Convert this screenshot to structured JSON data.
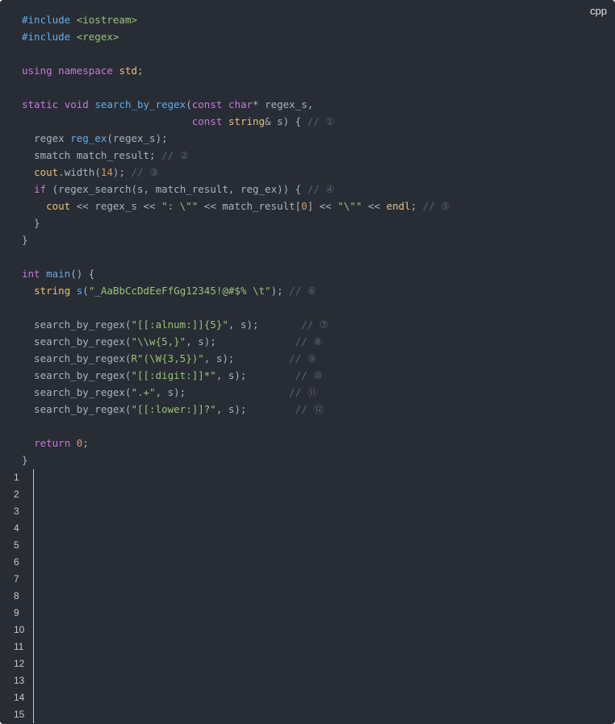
{
  "code_block": {
    "language_label": "cpp",
    "lines": [
      [
        [
          "meta",
          "#include "
        ],
        [
          "str",
          "<iostream>"
        ]
      ],
      [
        [
          "meta",
          "#include "
        ],
        [
          "str",
          "<regex>"
        ]
      ],
      [],
      [
        [
          "kw",
          "using"
        ],
        [
          "plain",
          " "
        ],
        [
          "kw",
          "namespace"
        ],
        [
          "plain",
          " "
        ],
        [
          "builtin",
          "std"
        ],
        [
          "plain",
          ";"
        ]
      ],
      [],
      [
        [
          "kw",
          "static"
        ],
        [
          "plain",
          " "
        ],
        [
          "type",
          "void"
        ],
        [
          "plain",
          " "
        ],
        [
          "fn",
          "search_by_regex"
        ],
        [
          "plain",
          "("
        ],
        [
          "kw",
          "const"
        ],
        [
          "plain",
          " "
        ],
        [
          "type",
          "char"
        ],
        [
          "plain",
          "* regex_s,"
        ]
      ],
      [
        [
          "plain",
          "                            "
        ],
        [
          "kw",
          "const"
        ],
        [
          "plain",
          " "
        ],
        [
          "builtin",
          "string"
        ],
        [
          "plain",
          "& s) { "
        ],
        [
          "cm",
          "// ①"
        ]
      ],
      [
        [
          "plain",
          "  regex "
        ],
        [
          "fn",
          "reg_ex"
        ],
        [
          "plain",
          "(regex_s);"
        ]
      ],
      [
        [
          "plain",
          "  smatch match_result; "
        ],
        [
          "cm",
          "// ②"
        ]
      ],
      [
        [
          "plain",
          "  "
        ],
        [
          "builtin",
          "cout"
        ],
        [
          "plain",
          ".width("
        ],
        [
          "num",
          "14"
        ],
        [
          "plain",
          "); "
        ],
        [
          "cm",
          "// ③"
        ]
      ],
      [
        [
          "plain",
          "  "
        ],
        [
          "kw",
          "if"
        ],
        [
          "plain",
          " (regex_search(s, match_result, reg_ex)) { "
        ],
        [
          "cm",
          "// ④"
        ]
      ],
      [
        [
          "plain",
          "    "
        ],
        [
          "builtin",
          "cout"
        ],
        [
          "plain",
          " << regex_s << "
        ],
        [
          "str",
          "\": \\\"\""
        ],
        [
          "plain",
          " << match_result["
        ],
        [
          "num",
          "0"
        ],
        [
          "plain",
          "] << "
        ],
        [
          "str",
          "\"\\\"\""
        ],
        [
          "plain",
          " << "
        ],
        [
          "builtin",
          "endl"
        ],
        [
          "plain",
          "; "
        ],
        [
          "cm",
          "// ⑤"
        ]
      ],
      [
        [
          "plain",
          "  }"
        ]
      ],
      [
        [
          "plain",
          "}"
        ]
      ],
      [],
      [
        [
          "type",
          "int"
        ],
        [
          "plain",
          " "
        ],
        [
          "fn",
          "main"
        ],
        [
          "plain",
          "() {"
        ]
      ],
      [
        [
          "plain",
          "  "
        ],
        [
          "builtin",
          "string"
        ],
        [
          "plain",
          " "
        ],
        [
          "fn",
          "s"
        ],
        [
          "plain",
          "("
        ],
        [
          "str",
          "\"_AaBbCcDdEeFfGg12345!@#$% \\t\""
        ],
        [
          "plain",
          "); "
        ],
        [
          "cm",
          "// ⑥"
        ]
      ],
      [],
      [
        [
          "plain",
          "  search_by_regex("
        ],
        [
          "str",
          "\"[[:alnum:]]{5}\""
        ],
        [
          "plain",
          ", s);       "
        ],
        [
          "cm",
          "// ⑦"
        ]
      ],
      [
        [
          "plain",
          "  search_by_regex("
        ],
        [
          "str",
          "\"\\\\w{5,}\""
        ],
        [
          "plain",
          ", s);             "
        ],
        [
          "cm",
          "// ⑧"
        ]
      ],
      [
        [
          "plain",
          "  search_by_regex("
        ],
        [
          "str",
          "R\"(\\W{3,5})\""
        ],
        [
          "plain",
          ", s);         "
        ],
        [
          "cm",
          "// ⑨"
        ]
      ],
      [
        [
          "plain",
          "  search_by_regex("
        ],
        [
          "str",
          "\"[[:digit:]]*\""
        ],
        [
          "plain",
          ", s);        "
        ],
        [
          "cm",
          "// ⑩"
        ]
      ],
      [
        [
          "plain",
          "  search_by_regex("
        ],
        [
          "str",
          "\".+\""
        ],
        [
          "plain",
          ", s);                 "
        ],
        [
          "cm",
          "// ⑪"
        ]
      ],
      [
        [
          "plain",
          "  search_by_regex("
        ],
        [
          "str",
          "\"[[:lower:]]?\""
        ],
        [
          "plain",
          ", s);        "
        ],
        [
          "cm",
          "// ⑫"
        ]
      ],
      [],
      [
        [
          "plain",
          "  "
        ],
        [
          "kw",
          "return"
        ],
        [
          "plain",
          " "
        ],
        [
          "num",
          "0"
        ],
        [
          "plain",
          ";"
        ]
      ],
      [
        [
          "plain",
          "}"
        ]
      ]
    ],
    "line_numbers": [
      "1",
      "2",
      "3",
      "4",
      "5",
      "6",
      "7",
      "8",
      "9",
      "10",
      "11",
      "12",
      "13",
      "14",
      "15"
    ]
  }
}
